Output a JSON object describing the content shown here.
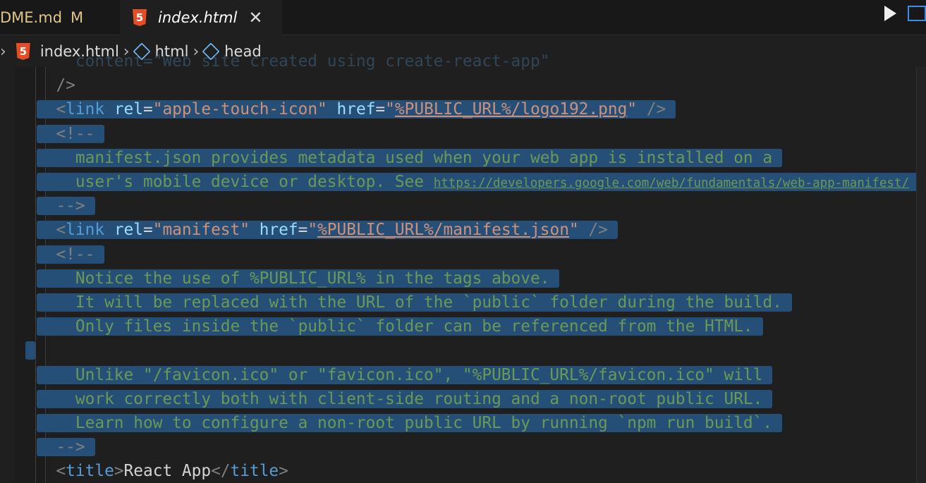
{
  "tabs": [
    {
      "label": "DME.md",
      "badge": "M"
    },
    {
      "label": "index.html",
      "icon": "html5-icon",
      "active": true,
      "close": "✕"
    }
  ],
  "breadcrumbs": [
    "index.html",
    "html",
    "head"
  ],
  "editor": {
    "lines": [
      [
        {
          "t": "    content=\"Web site created using create-react-app\"",
          "c": "faint"
        }
      ],
      [
        {
          "t": "  />",
          "c": "tag"
        }
      ],
      [
        {
          "t": "  <",
          "c": "tag",
          "sel": 1
        },
        {
          "t": "link",
          "c": "name"
        },
        {
          "t": " rel",
          "c": "attr"
        },
        {
          "t": "=",
          "c": "txt"
        },
        {
          "t": "\"apple-touch-icon\"",
          "c": "str"
        },
        {
          "t": " href",
          "c": "attr"
        },
        {
          "t": "=",
          "c": "txt"
        },
        {
          "t": "\"",
          "c": "str"
        },
        {
          "t": "%PUBLIC_URL%/logo192.png",
          "c": "url"
        },
        {
          "t": "\"",
          "c": "str"
        },
        {
          "t": " />",
          "c": "tag"
        }
      ],
      [
        {
          "t": "  <!--",
          "c": "tag"
        }
      ],
      [
        {
          "t": "    manifest.json provides metadata used when your web app is installed on a",
          "c": "cm"
        }
      ],
      [
        {
          "t": "    user's mobile device or desktop. See ",
          "c": "cm"
        },
        {
          "t": "https://developers.google.com/web/fundamentals/web-app-manifest/",
          "c": "cmurl"
        }
      ],
      [
        {
          "t": "  -->",
          "c": "tag"
        }
      ],
      [
        {
          "t": "  <",
          "c": "tag"
        },
        {
          "t": "link",
          "c": "name"
        },
        {
          "t": " rel",
          "c": "attr"
        },
        {
          "t": "=",
          "c": "txt"
        },
        {
          "t": "\"manifest\"",
          "c": "str"
        },
        {
          "t": " href",
          "c": "attr"
        },
        {
          "t": "=",
          "c": "txt"
        },
        {
          "t": "\"",
          "c": "str"
        },
        {
          "t": "%PUBLIC_URL%/manifest.json",
          "c": "url"
        },
        {
          "t": "\"",
          "c": "str"
        },
        {
          "t": " />",
          "c": "tag"
        }
      ],
      [
        {
          "t": "  <!--",
          "c": "tag"
        }
      ],
      [
        {
          "t": "    Notice the use of %PUBLIC_URL% in the tags above.",
          "c": "cm"
        }
      ],
      [
        {
          "t": "    It will be replaced with the URL of the `public` folder during the build.",
          "c": "cm"
        }
      ],
      [
        {
          "t": "    Only files inside the `public` folder can be referenced from the HTML.",
          "c": "cm"
        }
      ],
      [
        {
          "t": "",
          "c": "cm"
        }
      ],
      [
        {
          "t": "    Unlike \"/favicon.ico\" or \"favicon.ico\", \"%PUBLIC_URL%/favicon.ico\" will",
          "c": "cm"
        }
      ],
      [
        {
          "t": "    work correctly both with client-side routing and a non-root public URL.",
          "c": "cm"
        }
      ],
      [
        {
          "t": "    Learn how to configure a non-root public URL by running `npm run build`.",
          "c": "cm"
        }
      ],
      [
        {
          "t": "  -->",
          "c": "tag"
        }
      ],
      [
        {
          "t": "  <",
          "c": "tag"
        },
        {
          "t": "title",
          "c": "name"
        },
        {
          "t": ">",
          "c": "tag"
        },
        {
          "t": "React App",
          "c": "txt"
        },
        {
          "t": "</",
          "c": "tag"
        },
        {
          "t": "title",
          "c": "name"
        },
        {
          "t": ">",
          "c": "tag"
        }
      ]
    ]
  }
}
